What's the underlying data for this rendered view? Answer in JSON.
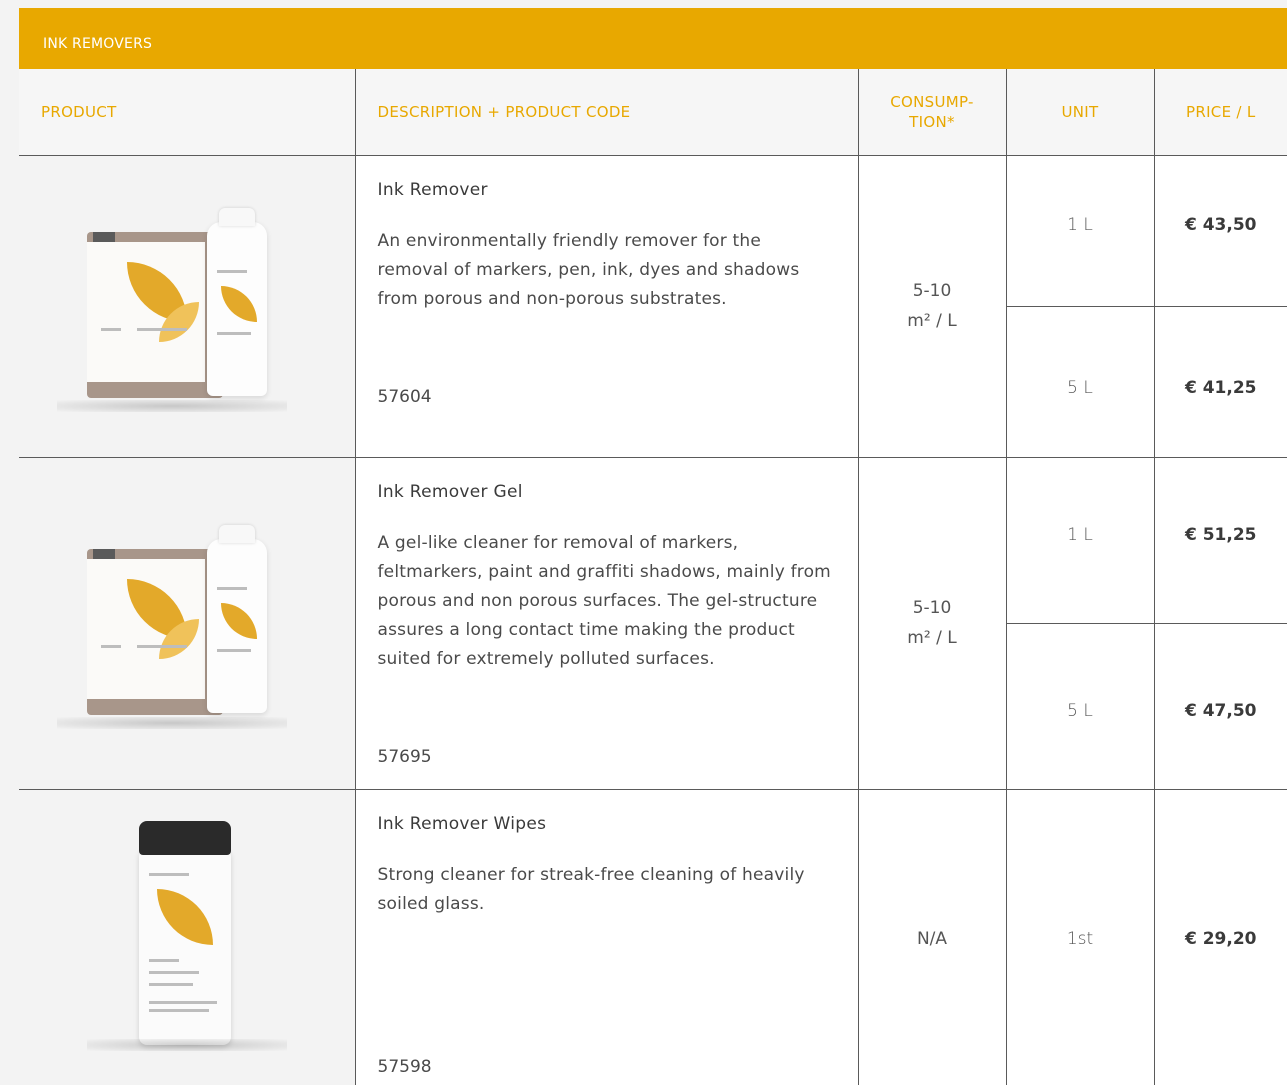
{
  "section": {
    "title": "INK REMOVERS"
  },
  "headers": {
    "product": "PRODUCT",
    "description": "DESCRIPTION + PRODUCT CODE",
    "consumption_line1": "CONSUMP-",
    "consumption_line2": "TION*",
    "unit": "UNIT",
    "price": "PRICE / L"
  },
  "colors": {
    "accent": "#e8a800",
    "border": "#5a5a5a",
    "jug": "#a8968a",
    "leaf": "#e3a92a"
  },
  "products": [
    {
      "name": "Ink Remover",
      "description": "An environmentally friendly remover for the removal of markers, pen, ink, dyes and shadows from porous and non-porous substrates.",
      "code": "57604",
      "consumption_line1": "5-10",
      "consumption_line2": "m² / L",
      "image_icon": "jug-and-bottle-image",
      "variants": [
        {
          "unit": "1 L",
          "price": "€ 43,50"
        },
        {
          "unit": "5 L",
          "price": "€ 41,25"
        }
      ]
    },
    {
      "name": "Ink Remover Gel",
      "description": "A gel-like cleaner for removal of markers, feltmarkers, paint and graffiti shadows, mainly from porous and non porous surfaces. The gel-structure assures a long contact time making the product suited for extremely polluted surfaces.",
      "code": "57695",
      "consumption_line1": "5-10",
      "consumption_line2": "m² / L",
      "image_icon": "jug-and-bottle-image",
      "variants": [
        {
          "unit": "1 L",
          "price": "€ 51,25"
        },
        {
          "unit": "5 L",
          "price": "€ 47,50"
        }
      ]
    },
    {
      "name": "Ink Remover Wipes",
      "description": "Strong cleaner for streak-free cleaning of heavily soiled glass.",
      "code": "57598",
      "consumption_line1": "N/A",
      "image_icon": "wipes-tub-image",
      "variants": [
        {
          "unit": "1st",
          "price": "€ 29,20"
        }
      ]
    }
  ]
}
